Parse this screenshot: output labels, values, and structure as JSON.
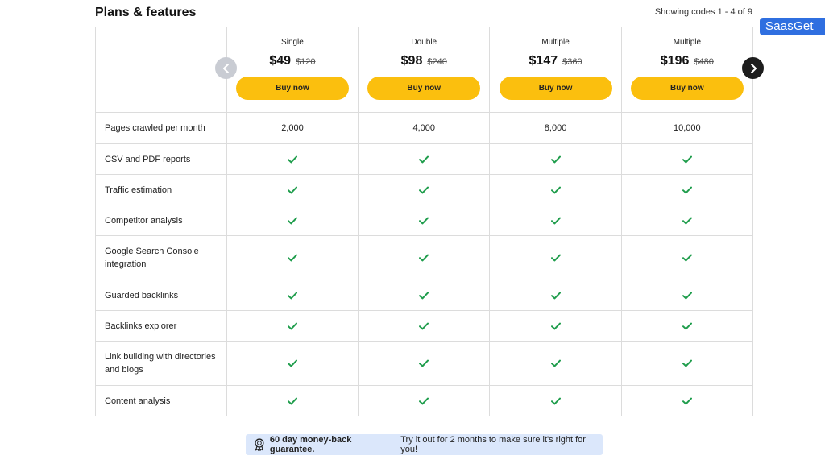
{
  "header": {
    "title": "Plans & features",
    "showing": "Showing codes 1 - 4 of 9"
  },
  "brand": {
    "label": "SaasGet"
  },
  "plans": [
    {
      "name": "Single",
      "price": "$49",
      "old_price": "$120",
      "buy_label": "Buy now"
    },
    {
      "name": "Double",
      "price": "$98",
      "old_price": "$240",
      "buy_label": "Buy now"
    },
    {
      "name": "Multiple",
      "price": "$147",
      "old_price": "$360",
      "buy_label": "Buy now"
    },
    {
      "name": "Multiple",
      "price": "$196",
      "old_price": "$480",
      "buy_label": "Buy now"
    }
  ],
  "features": [
    {
      "label": "Pages crawled per month",
      "values": [
        "2,000",
        "4,000",
        "8,000",
        "10,000"
      ]
    },
    {
      "label": "CSV and PDF reports",
      "values": [
        "check",
        "check",
        "check",
        "check"
      ]
    },
    {
      "label": "Traffic estimation",
      "values": [
        "check",
        "check",
        "check",
        "check"
      ]
    },
    {
      "label": "Competitor analysis",
      "values": [
        "check",
        "check",
        "check",
        "check"
      ]
    },
    {
      "label": "Google Search Console integration",
      "values": [
        "check",
        "check",
        "check",
        "check"
      ]
    },
    {
      "label": "Guarded backlinks",
      "values": [
        "check",
        "check",
        "check",
        "check"
      ]
    },
    {
      "label": "Backlinks explorer",
      "values": [
        "check",
        "check",
        "check",
        "check"
      ]
    },
    {
      "label": "Link building with directories and blogs",
      "values": [
        "check",
        "check",
        "check",
        "check"
      ]
    },
    {
      "label": "Content analysis",
      "values": [
        "check",
        "check",
        "check",
        "check"
      ]
    }
  ],
  "guarantee": {
    "icon": "badge-icon",
    "bold_text": "60 day money-back guarantee.",
    "rest_text": "Try it out for 2 months to make sure it's right for you!"
  },
  "colors": {
    "buy_button": "#fbbf0e",
    "check": "#1f9d4c",
    "brand": "#2f6fe0",
    "guarantee_bg": "#dbe7fb"
  }
}
